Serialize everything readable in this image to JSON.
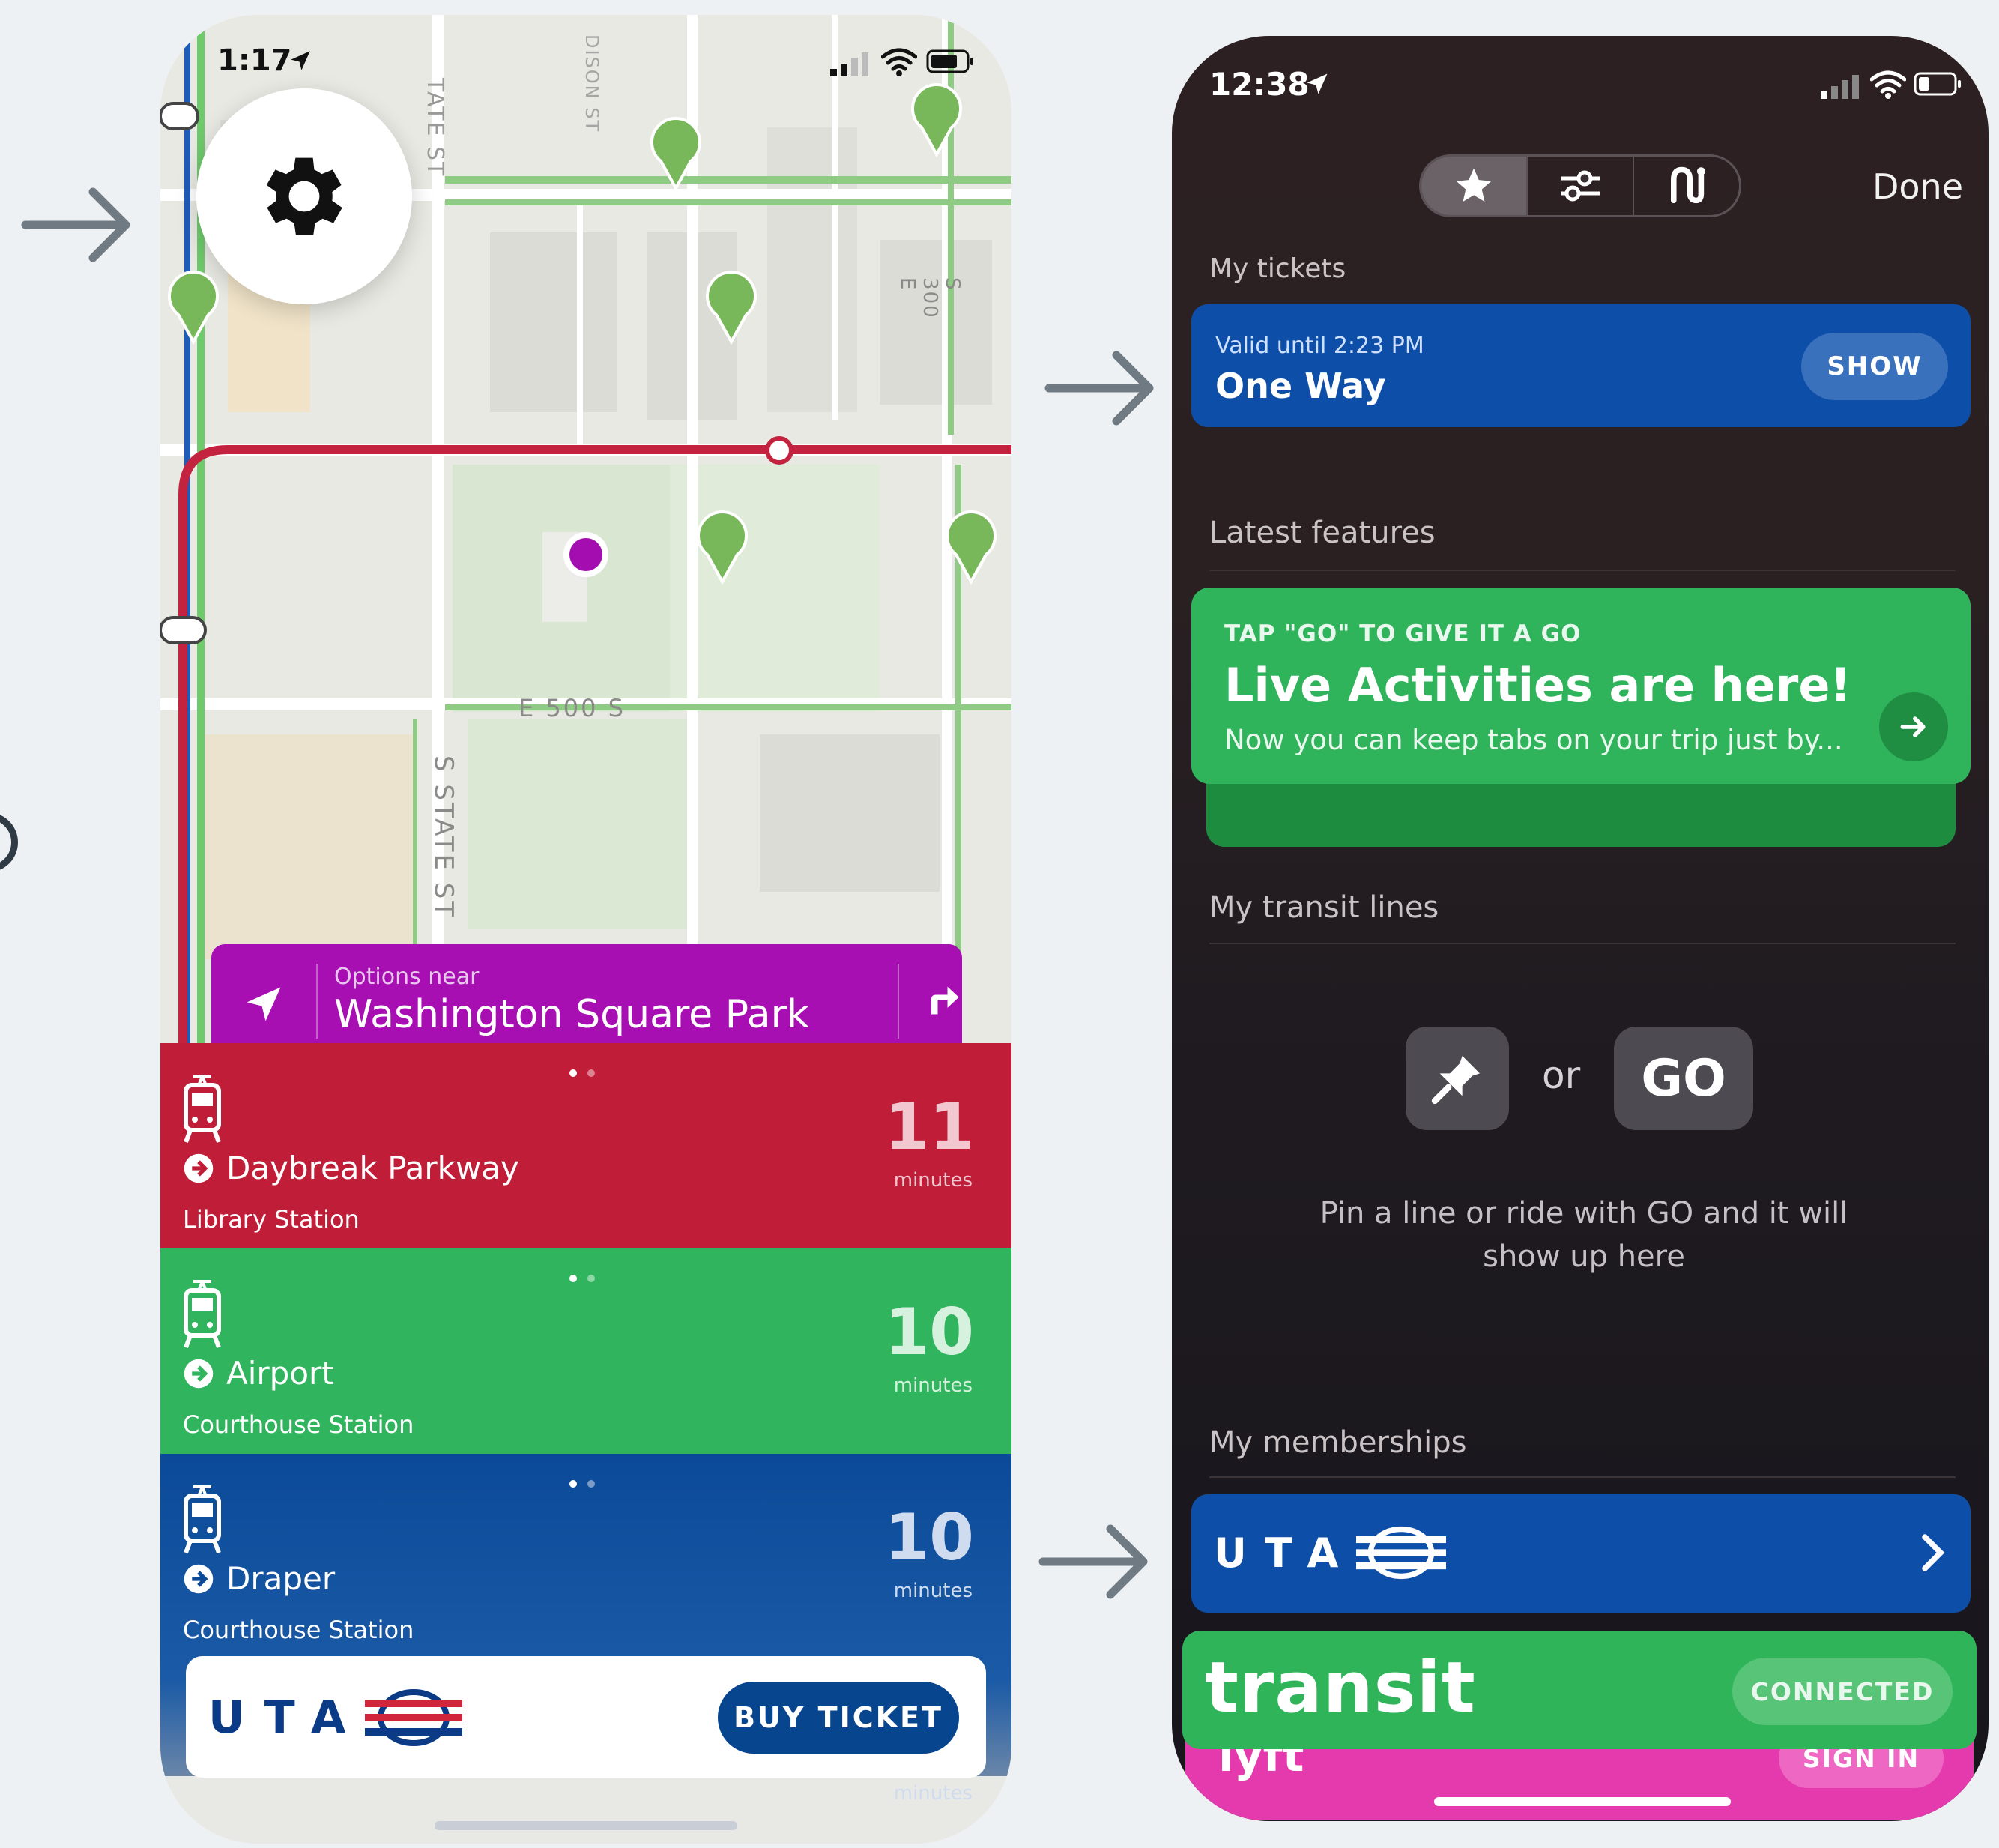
{
  "left_phone": {
    "status": {
      "time": "1:17"
    },
    "map": {
      "streets": [
        "TATE ST",
        "DISON ST",
        "S 300 E",
        "E 500 S",
        "S STATE ST"
      ]
    },
    "options_bar": {
      "label_small": "Options near",
      "label_big": "Washington Square Park"
    },
    "routes": [
      {
        "destination": "Daybreak Parkway",
        "station": "Library Station",
        "minutes": "11",
        "minutes_label": "minutes",
        "color": "#c01e38"
      },
      {
        "destination": "Airport",
        "station": "Courthouse Station",
        "minutes": "10",
        "minutes_label": "minutes",
        "color": "#31b45e"
      },
      {
        "destination": "Draper",
        "station": "Courthouse Station",
        "minutes": "10",
        "minutes_label": "minutes",
        "color": "#0b4a98"
      }
    ],
    "buy_bar": {
      "logo_letters": "UTA",
      "button_label": "BUY TICKET",
      "hidden_minutes_label": "minutes"
    }
  },
  "right_phone": {
    "status": {
      "time": "12:38"
    },
    "segments": [
      "star-icon",
      "sliders-icon",
      "go-route-icon"
    ],
    "done_label": "Done",
    "my_tickets": {
      "heading": "My tickets",
      "ticket": {
        "valid": "Valid until 2:23 PM",
        "name": "One Way",
        "button": "SHOW"
      }
    },
    "latest_features": {
      "heading": "Latest features",
      "tag": "TAP \"GO\" TO GIVE IT A GO",
      "title": "Live Activities are here!",
      "desc": "Now you can keep tabs on your trip just by..."
    },
    "my_transit_lines": {
      "heading": "My transit lines",
      "or_label": "or",
      "go_label": "GO",
      "hint_line1": "Pin a line or ride with GO and it will",
      "hint_line2": "show up here"
    },
    "my_memberships": {
      "heading": "My memberships",
      "uta_letters": "UTA",
      "transit_wordmark": "transit",
      "transit_button": "CONNECTED",
      "lyft_wordmark": "lyft",
      "lyft_button": "SIGN IN"
    }
  },
  "colors": {
    "background": "#eef1f3",
    "options_purple": "#a70fb2",
    "uta_blue": "#0b4a98",
    "transit_green": "#30b45a",
    "lyft_pink": "#e43aae"
  }
}
